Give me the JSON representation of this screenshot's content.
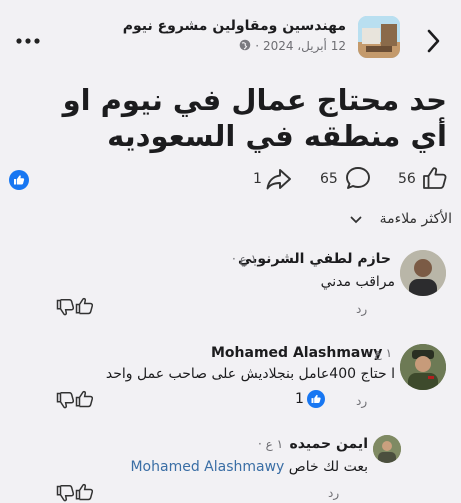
{
  "header": {
    "group_name": "مهندسين ومقاولين مشروع نيوم",
    "post_date": "12 أبريل، 2024 ·",
    "back_icon": "chevron-left-icon",
    "more_icon": "more-dots-icon",
    "audience_icon": "globe-icon"
  },
  "post": {
    "text": "حد محتاج عمال في نيوم او أي منطقه في السعوديه"
  },
  "stats": {
    "share_count": "1",
    "comment_count": "65",
    "like_count": "56"
  },
  "comments_header": {
    "sort_label": "الأكثر ملاءمة"
  },
  "comments": [
    {
      "author": "حازم لطفي الشرنوبي",
      "time": "١ ع ·",
      "body": "مراقب مدني",
      "reply_label": "رد",
      "reactions": ""
    },
    {
      "author": "Mohamed Alashmawy",
      "time": "١ ع ·",
      "body": "ا حتاج 400عامل بنجلاديش على صاحب عمل واحد",
      "reply_label": "رد",
      "reactions": "1"
    },
    {
      "author": "ايمن حميده",
      "time": "١ ع ·",
      "mention": "Mohamed Alashmawy",
      "body": "بعت لك خاص",
      "reply_label": "رد"
    }
  ],
  "colors": {
    "background": "#f2f1f4",
    "like_blue": "#1877f2",
    "mention_blue": "#3a6ea5"
  }
}
